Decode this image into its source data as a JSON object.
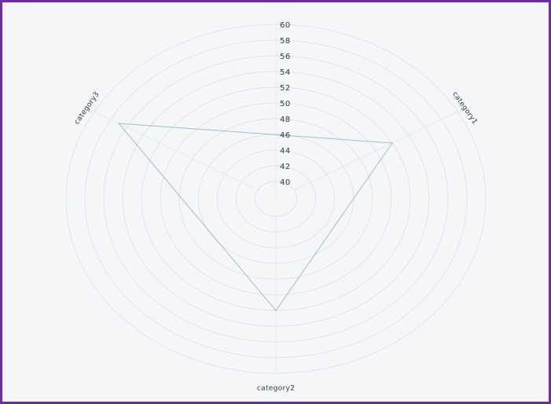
{
  "chart_data": {
    "type": "radar",
    "categories": [
      "category1",
      "category2",
      "category3"
    ],
    "series": [
      {
        "values": [
          52,
          52,
          57
        ],
        "color": "#93c2d8"
      }
    ],
    "rlim": [
      40,
      60
    ],
    "ticks": [
      40,
      42,
      44,
      46,
      48,
      50,
      52,
      54,
      56,
      58,
      60
    ],
    "grid": true,
    "grid_color": "#dcdfe4",
    "axis_line_color": "#e3e6ea"
  },
  "colors": {
    "frame_border": "#6b2e9a",
    "background": "#f5f6f8"
  }
}
